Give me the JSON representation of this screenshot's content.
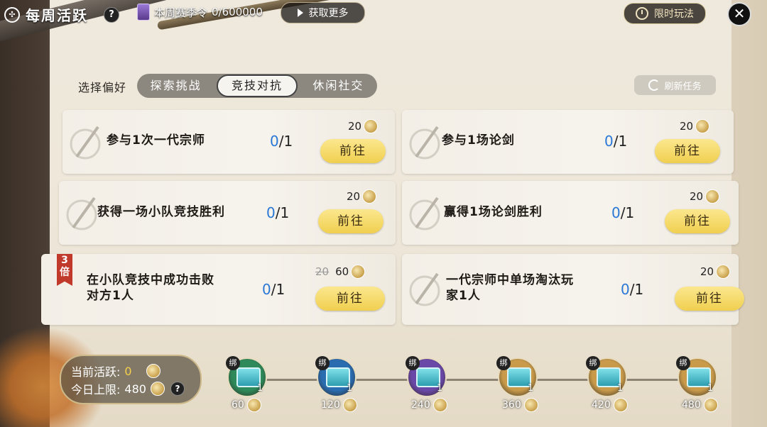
{
  "header": {
    "title": "每周活跃",
    "help": "?",
    "season_label": "本周赛季令",
    "season_value": "0/600000",
    "get_more": "获取更多",
    "limited": "限时玩法",
    "close": "✕"
  },
  "preference": {
    "label": "选择偏好",
    "tabs": [
      "探索挑战",
      "竞技对抗",
      "休闲社交"
    ],
    "active_tab": "竞技对抗",
    "refresh": "刷新任务"
  },
  "tasks": [
    {
      "text": "参与1次一代宗师",
      "cur": "0",
      "total": "/1",
      "reward": "20",
      "button": "前往"
    },
    {
      "text": "参与1场论剑",
      "cur": "0",
      "total": "/1",
      "reward": "20",
      "button": "前往"
    },
    {
      "text": "获得一场小队竞技胜利",
      "cur": "0",
      "total": "/1",
      "reward": "20",
      "button": "前往"
    },
    {
      "text": "赢得1场论剑胜利",
      "cur": "0",
      "total": "/1",
      "reward": "20",
      "button": "前往"
    },
    {
      "text_line1": "在小队竞技中成功击败",
      "text_line2": "对方1人",
      "cur": "0",
      "total": "/1",
      "old_reward": "20",
      "reward": "60",
      "badge_num": "3",
      "badge_unit": "倍",
      "button": "前往"
    },
    {
      "text_line1": "一代宗师中单场淘汰玩",
      "text_line2": "家1人",
      "cur": "0",
      "total": "/1",
      "reward": "20",
      "button": "前往"
    }
  ],
  "activity": {
    "current_label": "当前活跃:",
    "current_value": "0",
    "limit_label": "今日上限:",
    "limit_value": "480",
    "help": "?"
  },
  "chests": [
    {
      "bind": "绑",
      "count": "1",
      "threshold": "60",
      "color": "#2e8a5a"
    },
    {
      "bind": "绑",
      "count": "1",
      "threshold": "120",
      "color": "#2a6cb0"
    },
    {
      "bind": "绑",
      "count": "1",
      "threshold": "240",
      "color": "#6a48a8"
    },
    {
      "bind": "绑",
      "count": "1",
      "threshold": "360",
      "color": "#c89a4a"
    },
    {
      "bind": "绑",
      "count": "1",
      "threshold": "420",
      "color": "#c89a4a"
    },
    {
      "bind": "绑",
      "count": "1",
      "threshold": "480",
      "color": "#c89a4a"
    }
  ]
}
